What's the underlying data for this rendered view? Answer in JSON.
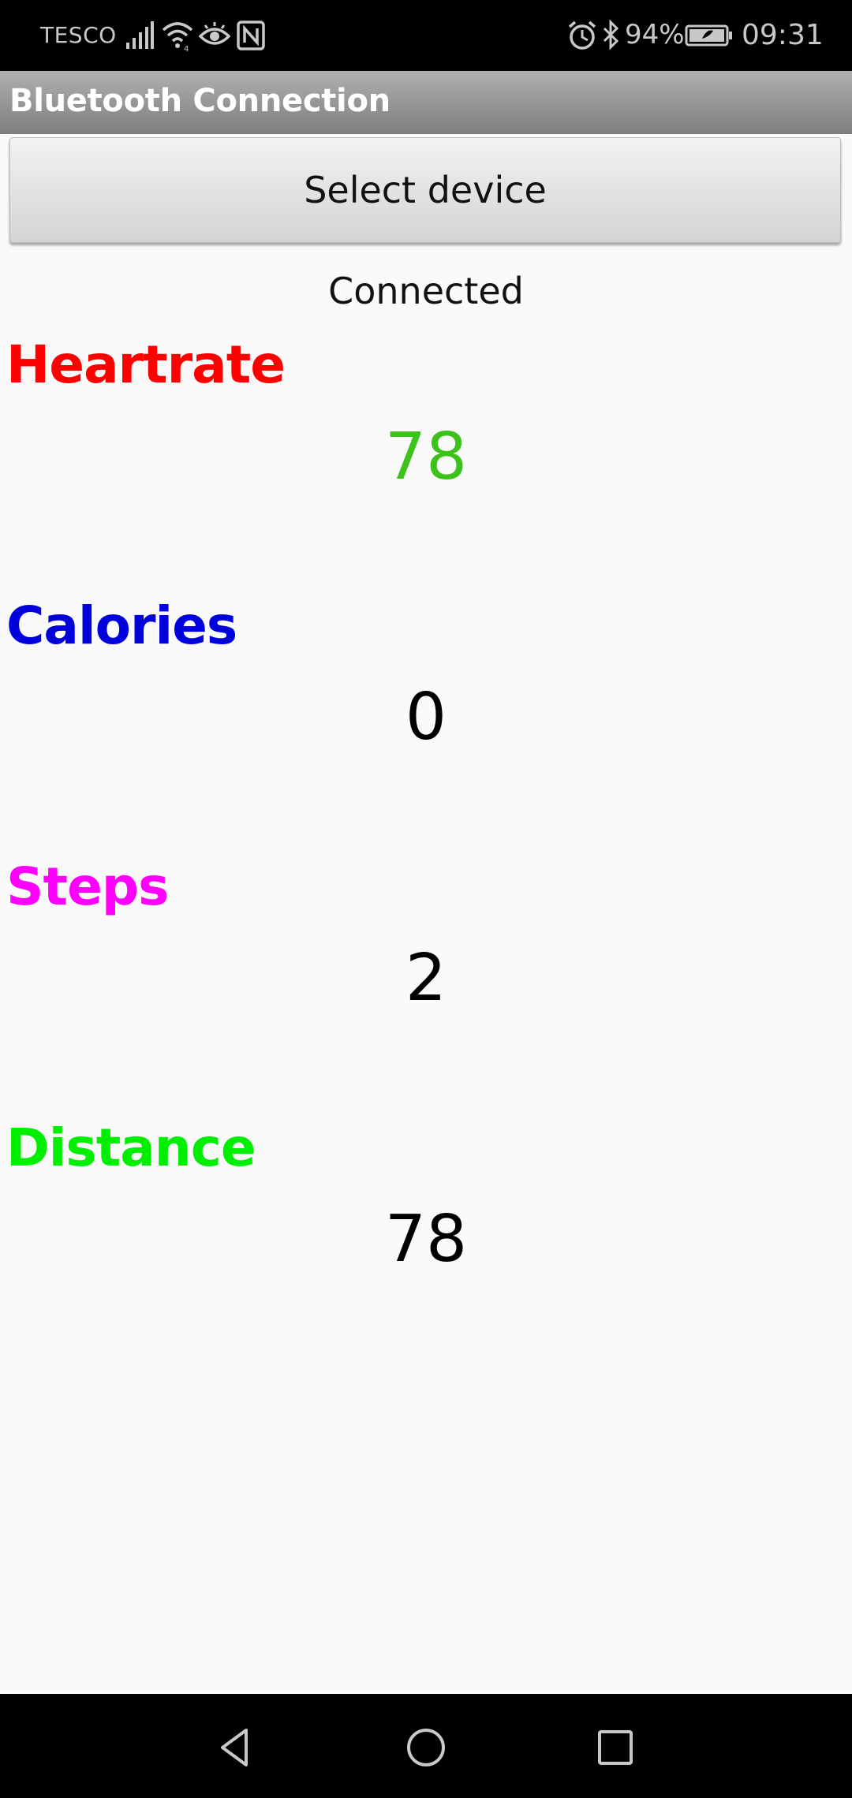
{
  "status_bar": {
    "carrier": "TESCO",
    "battery_percent": "94%",
    "time": "09:31",
    "icons": [
      "signal-icon",
      "wifi-icon",
      "eye-icon",
      "nfc-icon",
      "alarm-icon",
      "bluetooth-icon",
      "battery-icon"
    ]
  },
  "title_bar": {
    "title": "Bluetooth Connection"
  },
  "select_button": {
    "label": "Select device"
  },
  "connection_status": "Connected",
  "metrics": [
    {
      "label": "Heartrate",
      "value": "78",
      "label_color": "#ff0000",
      "value_color": "#3dc21b"
    },
    {
      "label": "Calories",
      "value": "0",
      "label_color": "#0000dd",
      "value_color": "#000000"
    },
    {
      "label": "Steps",
      "value": "2",
      "label_color": "#ff00ff",
      "value_color": "#000000"
    },
    {
      "label": "Distance",
      "value": "78",
      "label_color": "#00ee00",
      "value_color": "#000000"
    }
  ],
  "nav_bar": {
    "buttons": [
      "back-icon",
      "home-icon",
      "recents-icon"
    ]
  }
}
